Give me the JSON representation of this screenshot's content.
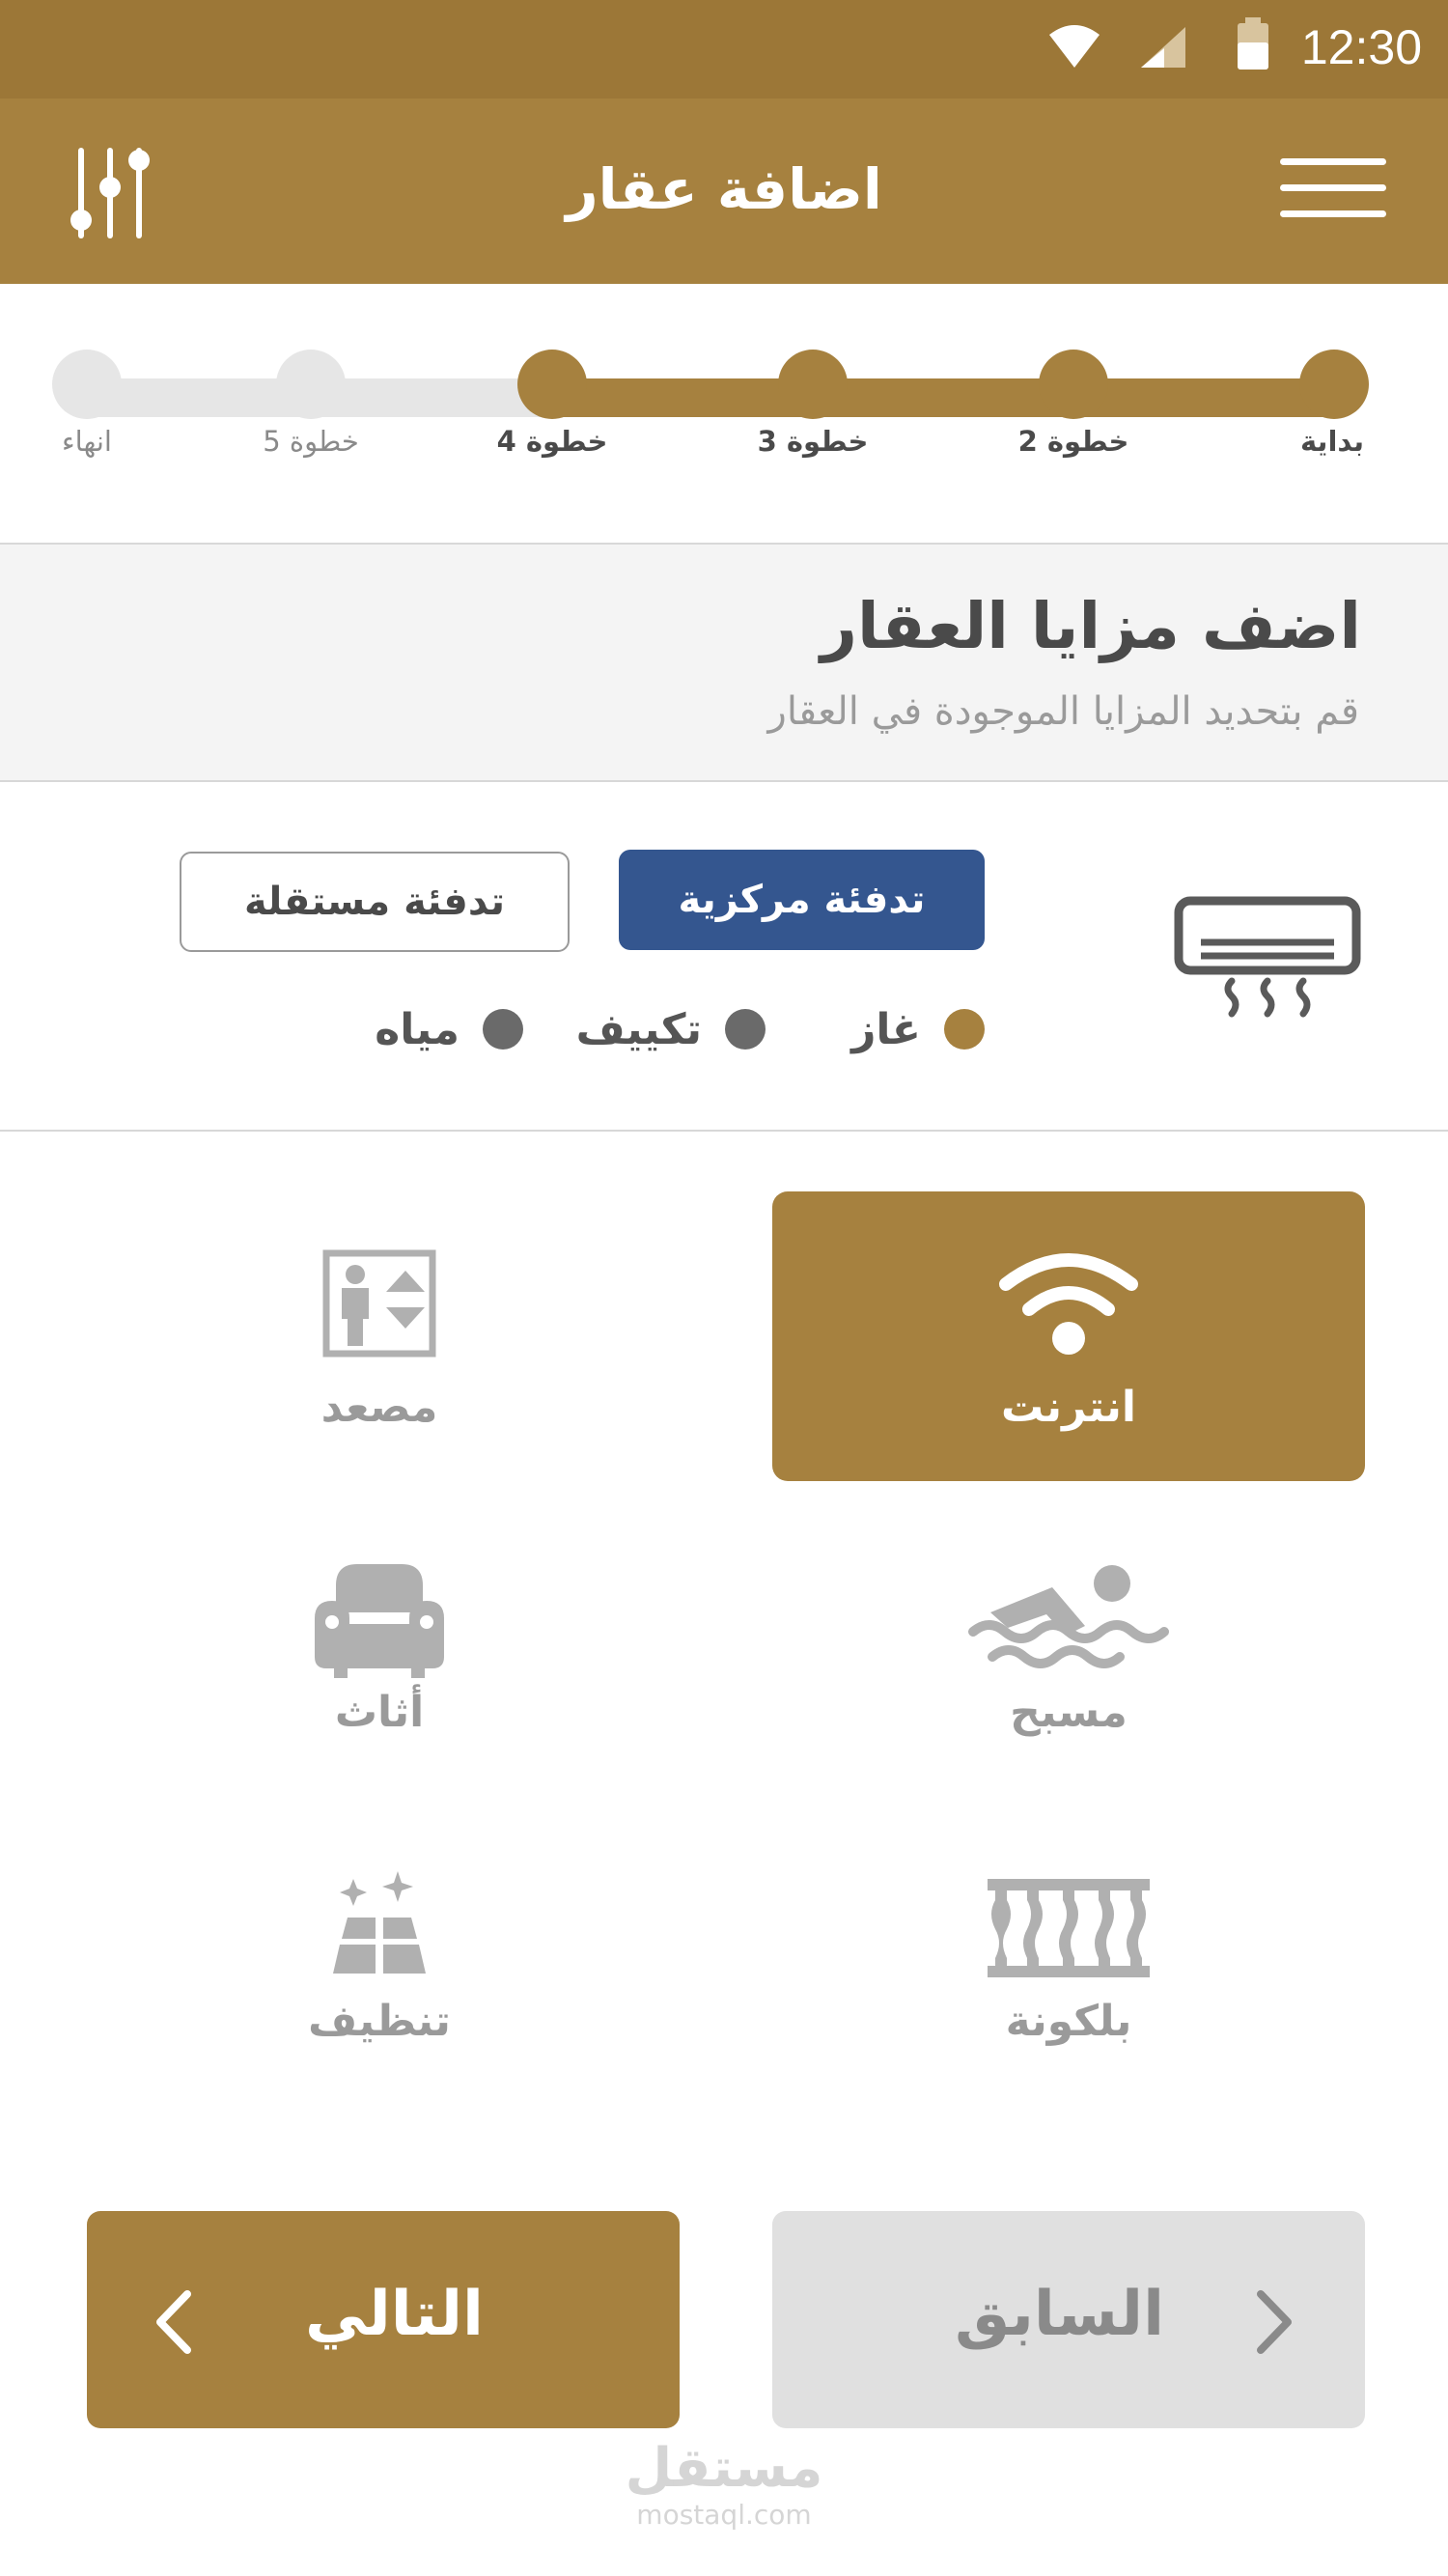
{
  "status_bar": {
    "time": "12:30"
  },
  "app_bar": {
    "title": "اضافة عقار"
  },
  "stepper": {
    "steps": [
      {
        "label": "بداية",
        "done": true
      },
      {
        "label": "خطوة 2",
        "done": true
      },
      {
        "label": "خطوة 3",
        "done": true
      },
      {
        "label": "خطوة 4",
        "done": true
      },
      {
        "label": "خطوة 5",
        "done": false
      },
      {
        "label": "انهاء",
        "done": false
      }
    ]
  },
  "section": {
    "title": "اضف مزايا العقار",
    "subtitle": "قم بتحديد المزايا الموجودة في العقار"
  },
  "heating": {
    "icon": "air-conditioner-icon",
    "options": [
      {
        "label": "تدفئة مركزية",
        "selected": true
      },
      {
        "label": "تدفئة مستقلة",
        "selected": false
      }
    ],
    "sources": [
      {
        "label": "غاز",
        "selected": true
      },
      {
        "label": "تكييف",
        "selected": false
      },
      {
        "label": "مياه",
        "selected": false
      }
    ]
  },
  "features": [
    {
      "label": "انترنت",
      "icon": "wifi-icon",
      "selected": true
    },
    {
      "label": "مصعد",
      "icon": "elevator-icon",
      "selected": false
    },
    {
      "label": "مسبح",
      "icon": "swimming-icon",
      "selected": false
    },
    {
      "label": "أثاث",
      "icon": "armchair-icon",
      "selected": false
    },
    {
      "label": "بلكونة",
      "icon": "balcony-icon",
      "selected": false
    },
    {
      "label": "تنظيف",
      "icon": "cleaning-icon",
      "selected": false
    }
  ],
  "nav": {
    "prev_label": "السابق",
    "next_label": "التالي"
  },
  "watermark": {
    "brand": "مستقل",
    "domain": "mostaql.com"
  },
  "colors": {
    "gold": "#a6813f",
    "status_gold": "#9c7737",
    "blue": "#34568f",
    "inactive": "#e6e6e6",
    "icon_gray": "#b0b0b0"
  }
}
